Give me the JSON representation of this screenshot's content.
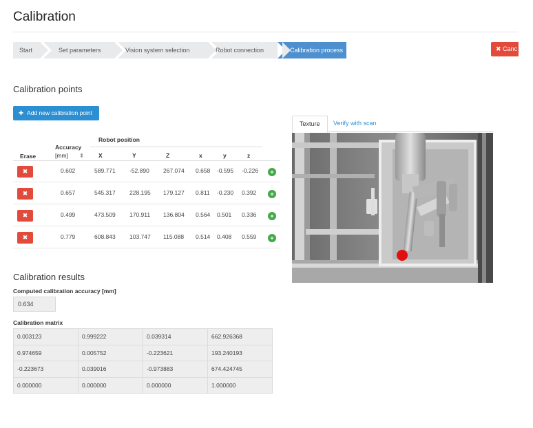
{
  "page": {
    "title": "Calibration"
  },
  "wizard": {
    "steps": [
      {
        "label": "Start",
        "active": false
      },
      {
        "label": "Set parameters",
        "active": false
      },
      {
        "label": "Vision system selection",
        "active": false
      },
      {
        "label": "Robot connection",
        "active": false
      },
      {
        "label": "Calibration process",
        "active": true
      }
    ],
    "cancel_label": "Canc"
  },
  "points": {
    "heading": "Calibration points",
    "add_label": "Add new calibration point",
    "headers": {
      "erase": "Erase",
      "accuracy_line1": "Accuracy",
      "accuracy_line2": "[mm]",
      "robot_position": "Robot position",
      "X": "X",
      "Y": "Y",
      "Z": "Z",
      "x": "x",
      "y": "y",
      "z": "z"
    },
    "rows": [
      {
        "accuracy": "0.602",
        "X": "589.771",
        "Y": "-52.890",
        "Z": "267.074",
        "x": "0.658",
        "y": "-0.595",
        "z": "-0.226"
      },
      {
        "accuracy": "0.657",
        "X": "545.317",
        "Y": "228.195",
        "Z": "179.127",
        "x": "0.811",
        "y": "-0.230",
        "z": "0.392"
      },
      {
        "accuracy": "0.499",
        "X": "473.509",
        "Y": "170.911",
        "Z": "136.804",
        "x": "0.564",
        "y": "0.501",
        "z": "0.336"
      },
      {
        "accuracy": "0.779",
        "X": "608.843",
        "Y": "103.747",
        "Z": "115.088",
        "x": "0.514",
        "y": "0.408",
        "z": "0.559"
      }
    ]
  },
  "results": {
    "heading": "Calibration results",
    "accuracy_label": "Computed calibration accuracy [mm]",
    "accuracy_value": "0.634",
    "matrix_label": "Calibration matrix",
    "matrix": [
      [
        "0.003123",
        "0.999222",
        "0.039314",
        "662.926368"
      ],
      [
        "0.974659",
        "0.005752",
        "-0.223621",
        "193.240193"
      ],
      [
        "-0.223673",
        "0.039016",
        "-0.973883",
        "674.424745"
      ],
      [
        "0.000000",
        "0.000000",
        "0.000000",
        "1.000000"
      ]
    ]
  },
  "view": {
    "tabs": [
      {
        "label": "Texture",
        "active": true
      },
      {
        "label": "Verify with scan",
        "active": false
      }
    ]
  },
  "icons": {
    "cancel": "close-icon",
    "add": "plus-icon",
    "erase": "close-icon",
    "move_to": "plus-circle-icon",
    "sort": "sort-icon"
  },
  "colors": {
    "primary": "#2c8fd1",
    "active_step": "#4d8fcf",
    "danger": "#e24b3b",
    "success": "#44a948",
    "step_bg": "#e9eaec"
  }
}
